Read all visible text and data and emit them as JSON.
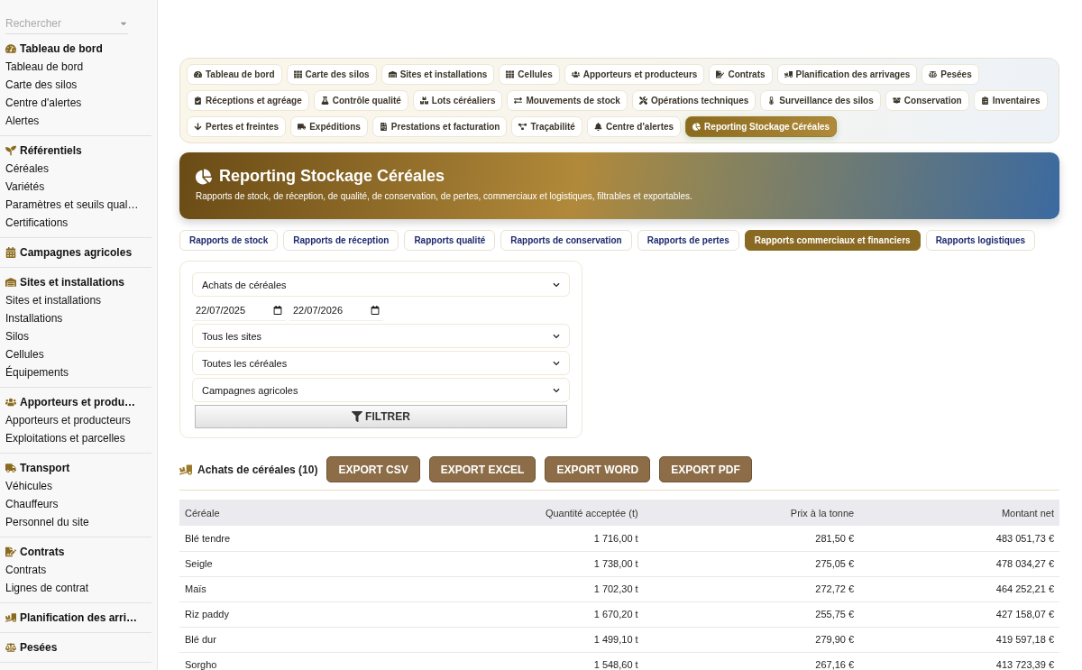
{
  "sidebar": {
    "search": {
      "placeholder": "Rechercher"
    },
    "sections": [
      {
        "title": "Tableau de bord",
        "items": [
          "Tableau de bord",
          "Carte des silos",
          "Centre d'alertes",
          "Alertes"
        ]
      },
      {
        "title": "Référentiels",
        "items": [
          "Céréales",
          "Variétés",
          "Paramètres et seuils qual…",
          "Certifications"
        ]
      },
      {
        "title": "Campagnes agricoles"
      },
      {
        "title": "Sites et installations",
        "items": [
          "Sites et installations",
          "Installations",
          "Silos",
          "Cellules",
          "Équipements"
        ]
      },
      {
        "title": "Apporteurs et produ…",
        "items": [
          "Apporteurs et producteurs",
          "Exploitations et parcelles"
        ]
      },
      {
        "title": "Transport",
        "items": [
          "Véhicules",
          "Chauffeurs",
          "Personnel du site"
        ]
      },
      {
        "title": "Contrats",
        "items": [
          "Contrats",
          "Lignes de contrat"
        ]
      },
      {
        "title": "Planification des arri…"
      },
      {
        "title": "Pesées"
      }
    ]
  },
  "modules": [
    {
      "label": "Tableau de bord",
      "selected": false
    },
    {
      "label": "Carte des silos",
      "selected": false
    },
    {
      "label": "Sites et installations",
      "selected": false
    },
    {
      "label": "Cellules",
      "selected": false
    },
    {
      "label": "Apporteurs et producteurs",
      "selected": false
    },
    {
      "label": "Contrats",
      "selected": false
    },
    {
      "label": "Planification des arrivages",
      "selected": false
    },
    {
      "label": "Pesées",
      "selected": false
    },
    {
      "label": "Réceptions et agréage",
      "selected": false
    },
    {
      "label": "Contrôle qualité",
      "selected": false
    },
    {
      "label": "Lots céréaliers",
      "selected": false
    },
    {
      "label": "Mouvements de stock",
      "selected": false
    },
    {
      "label": "Opérations techniques",
      "selected": false
    },
    {
      "label": "Surveillance des silos",
      "selected": false
    },
    {
      "label": "Conservation",
      "selected": false
    },
    {
      "label": "Inventaires",
      "selected": false
    },
    {
      "label": "Pertes et freintes",
      "selected": false
    },
    {
      "label": "Expéditions",
      "selected": false
    },
    {
      "label": "Prestations et facturation",
      "selected": false
    },
    {
      "label": "Traçabilité",
      "selected": false
    },
    {
      "label": "Centre d'alertes",
      "selected": false
    },
    {
      "label": "Reporting Stockage Céréales",
      "selected": true
    }
  ],
  "banner": {
    "title": "Reporting Stockage Céréales",
    "subtitle": "Rapports de stock, de réception, de qualité, de conservation, de pertes, commerciaux et logistiques, filtrables et exportables."
  },
  "report_tabs": [
    {
      "label": "Rapports de stock",
      "selected": false
    },
    {
      "label": "Rapports de réception",
      "selected": false
    },
    {
      "label": "Rapports qualité",
      "selected": false
    },
    {
      "label": "Rapports de conservation",
      "selected": false
    },
    {
      "label": "Rapports de pertes",
      "selected": false
    },
    {
      "label": "Rapports commerciaux et financiers",
      "selected": true
    },
    {
      "label": "Rapports logistiques",
      "selected": false
    }
  ],
  "filters": {
    "report": "Achats de céréales",
    "date_from": "22/07/2025",
    "date_to": "22/07/2026",
    "site": "Tous les sites",
    "cereal": "Toutes les céréales",
    "campaign": "Campagnes agricoles",
    "button": "FILTRER"
  },
  "results": {
    "title": "Achats de céréales (10)",
    "exports": [
      "EXPORT CSV",
      "EXPORT EXCEL",
      "EXPORT WORD",
      "EXPORT PDF"
    ],
    "columns": [
      "Céréale",
      "Quantité acceptée (t)",
      "Prix à la tonne",
      "Montant net"
    ],
    "rows": [
      [
        "Blé tendre",
        "1 716,00 t",
        "281,50 €",
        "483 051,73 €"
      ],
      [
        "Seigle",
        "1 738,00 t",
        "275,05 €",
        "478 034,27 €"
      ],
      [
        "Maïs",
        "1 702,30 t",
        "272,72 €",
        "464 252,21 €"
      ],
      [
        "Riz paddy",
        "1 670,20 t",
        "255,75 €",
        "427 158,07 €"
      ],
      [
        "Blé dur",
        "1 499,10 t",
        "279,90 €",
        "419 597,18 €"
      ],
      [
        "Sorgho",
        "1 548,60 t",
        "267,16 €",
        "413 723,39 €"
      ]
    ]
  }
}
